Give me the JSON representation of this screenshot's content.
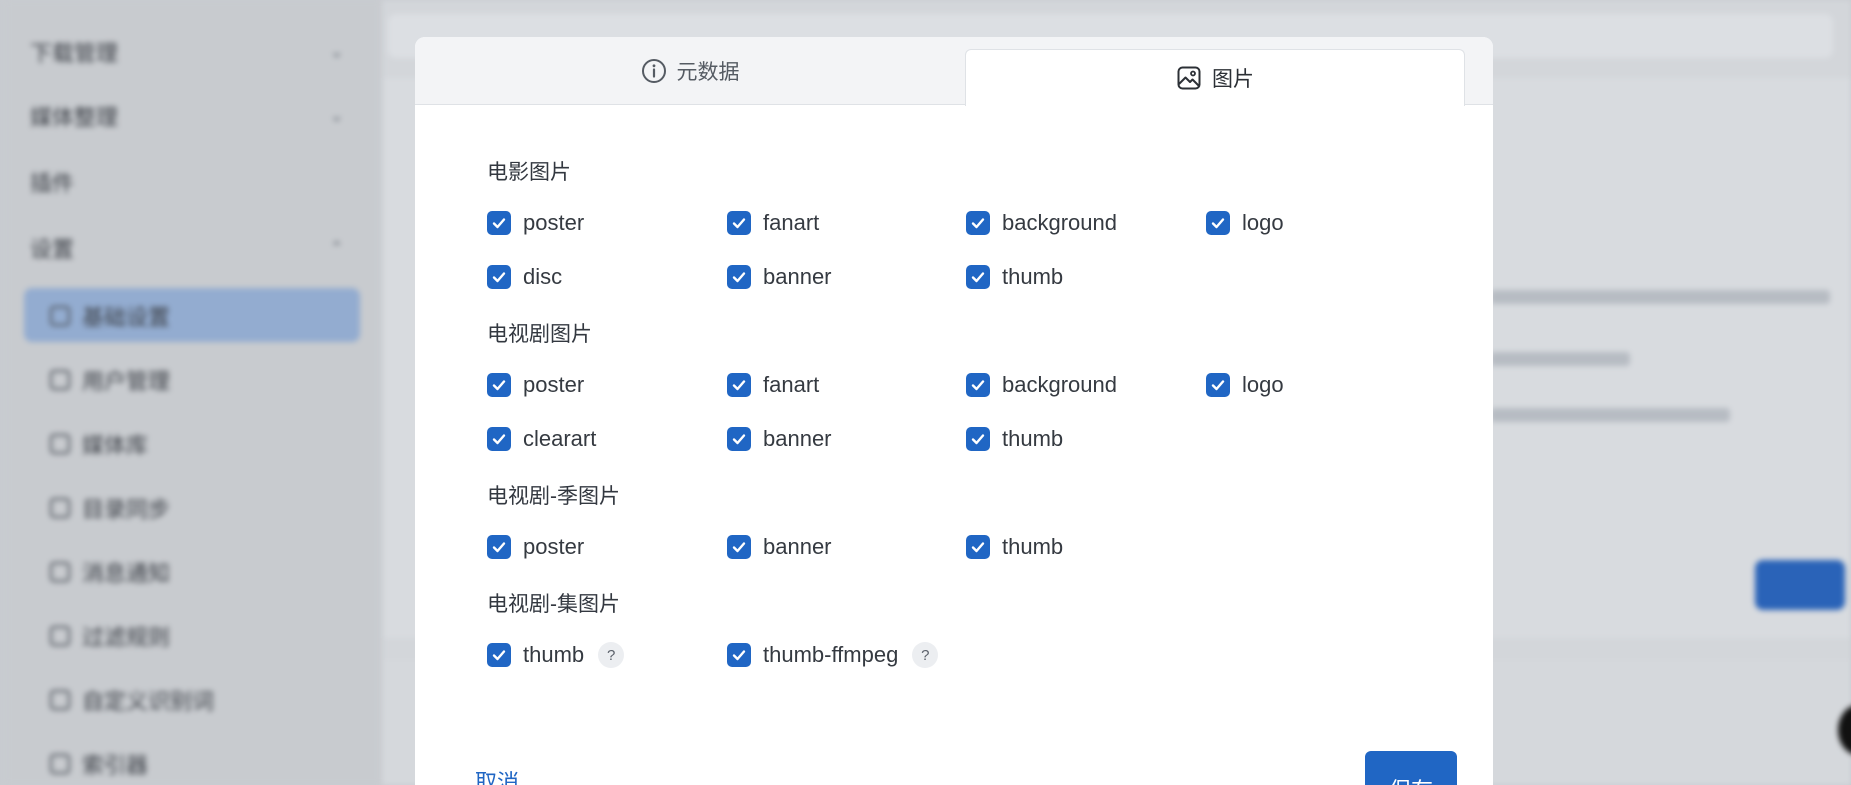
{
  "background": {
    "sidebar_items": [
      "下载管理",
      "媒体整理",
      "插件",
      "设置",
      "基础设置",
      "用户管理",
      "媒体库",
      "目录同步",
      "消息通知",
      "过滤规则",
      "自定义识别词",
      "索引器"
    ]
  },
  "tabs": [
    {
      "label": "元数据",
      "icon": "info-icon"
    },
    {
      "label": "图片",
      "icon": "image-icon"
    }
  ],
  "sections": [
    {
      "title": "电影图片",
      "options": [
        "poster",
        "fanart",
        "background",
        "logo",
        "disc",
        "banner",
        "thumb"
      ]
    },
    {
      "title": "电视剧图片",
      "options": [
        "poster",
        "fanart",
        "background",
        "logo",
        "clearart",
        "banner",
        "thumb"
      ]
    },
    {
      "title": "电视剧-季图片",
      "options": [
        "poster",
        "banner",
        "thumb"
      ]
    },
    {
      "title": "电视剧-集图片",
      "options": [
        "thumb",
        "thumb-ffmpeg"
      ]
    }
  ],
  "help_glyph": "?",
  "footer": {
    "cancel": "取消",
    "save": "保存"
  },
  "colors": {
    "accent": "#2066c4"
  }
}
